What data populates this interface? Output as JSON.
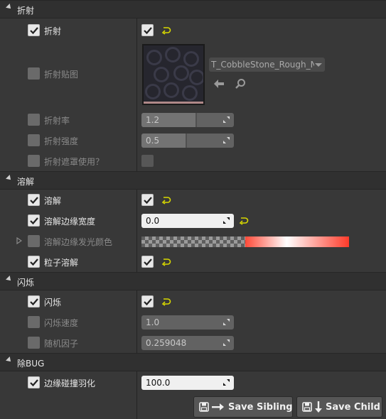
{
  "categories": {
    "refraction": "折射",
    "dissolve": "溶解",
    "flicker": "闪烁",
    "bug": "除BUG"
  },
  "rows": {
    "refraction": "折射",
    "refraction_map": "折射贴图",
    "refraction_rate": "折射率",
    "refraction_strength": "折射强度",
    "refraction_mask": "折射遮罩使用？",
    "dissolve": "溶解",
    "dissolve_edge_width": "溶解边缘宽度",
    "dissolve_edge_color": "溶解边缘发光颜色",
    "particle_dissolve": "粒子溶解",
    "flicker": "闪烁",
    "flicker_speed": "闪烁速度",
    "random_factor": "随机因子",
    "edge_collision_feather": "边缘碰撞羽化"
  },
  "values": {
    "refraction_map_asset": "T_CobbleStone_Rough_N",
    "refraction_rate": "1.2",
    "refraction_rate_fill": 0.5,
    "refraction_strength": "0.5",
    "refraction_strength_fill": 0.42,
    "dissolve_edge_width": "0.0",
    "flicker_speed": "1.0",
    "random_factor": "0.259048",
    "edge_collision_feather": "100.0"
  },
  "buttons": {
    "save_sibling": "Save Sibling",
    "save_child": "Save Child"
  },
  "colors": {
    "reset_arrow": "#d8d800",
    "gradient_start": "#ff4a38",
    "gradient_mid": "#ffffff",
    "gradient_end": "#ff3b2a"
  },
  "icons": {
    "checkbox_check": "check-icon",
    "reset": "reset-to-default-icon",
    "use_selected": "arrow-left-icon",
    "browse": "search-icon",
    "save": "save-icon"
  }
}
